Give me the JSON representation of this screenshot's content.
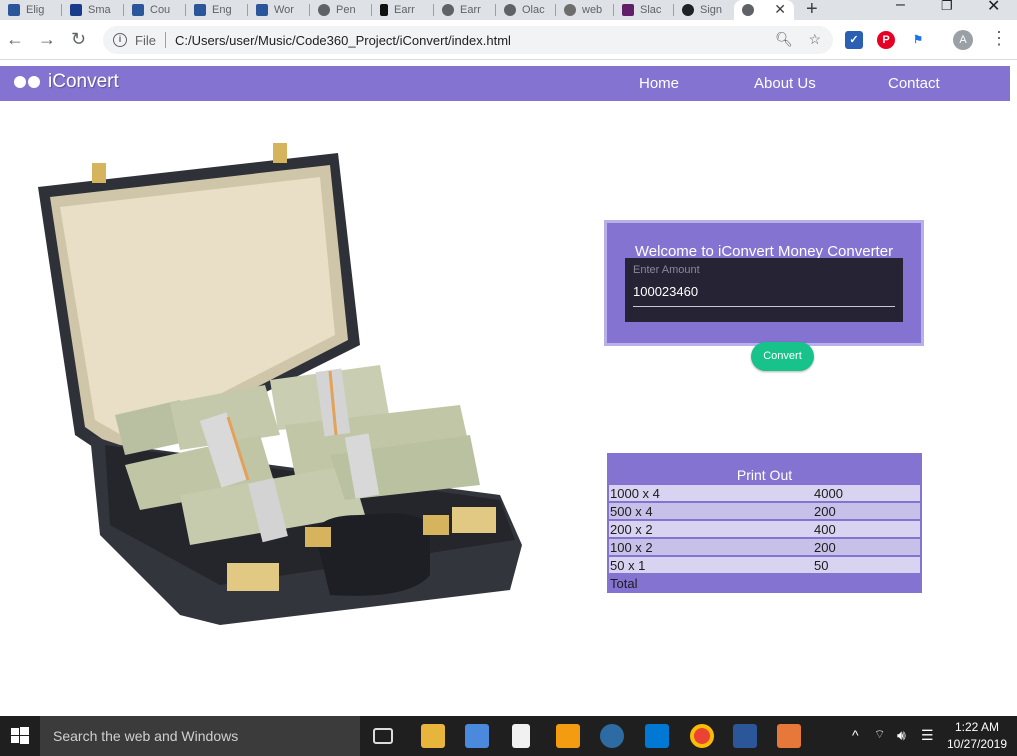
{
  "browser": {
    "tabs": [
      {
        "label": "Elig",
        "favicon_color": "#2b579a"
      },
      {
        "label": "Sma",
        "favicon_color": "#1a3a8a"
      },
      {
        "label": "Cou",
        "favicon_color": "#2b579a"
      },
      {
        "label": "Eng",
        "favicon_color": "#2b579a"
      },
      {
        "label": "Wor",
        "favicon_color": "#2b579a"
      },
      {
        "label": "Pen",
        "favicon_color": "#5f6368"
      },
      {
        "label": "Earr",
        "favicon_color": "#111111"
      },
      {
        "label": "Earr",
        "favicon_color": "#5f6368"
      },
      {
        "label": "Olac",
        "favicon_color": "#5f6368"
      },
      {
        "label": "web",
        "favicon_color": "#6d6d6d"
      },
      {
        "label": "Slac",
        "favicon_color": "#611f69"
      },
      {
        "label": "Sign",
        "favicon_color": "#202124"
      },
      {
        "label": "",
        "favicon_color": "#5f6368"
      }
    ],
    "new_tab_glyph": "+",
    "close_glyph": "✕",
    "url_prefix": "File",
    "url": "C:/Users/user/Music/Code360_Project/iConvert/index.html",
    "profile_initial": "A"
  },
  "site": {
    "brand": "iConvert",
    "nav": [
      "Home",
      "About Us",
      "Contact"
    ]
  },
  "converter": {
    "title": "Welcome to iConvert Money Converter",
    "input_label": "Enter Amount",
    "input_value": "100023460",
    "button_label": "Convert"
  },
  "printout": {
    "title": "Print Out",
    "rows": [
      {
        "denomination": "1000 x 4",
        "amount": "4000"
      },
      {
        "denomination": "500 x 4",
        "amount": "200"
      },
      {
        "denomination": "200 x 2",
        "amount": "400"
      },
      {
        "denomination": "100 x 2",
        "amount": "200"
      },
      {
        "denomination": "50 x 1",
        "amount": "50"
      }
    ],
    "total_label": "Total"
  },
  "taskbar": {
    "search_placeholder": "Search the web and Windows",
    "time": "1:22 AM",
    "date": "10/27/2019"
  }
}
